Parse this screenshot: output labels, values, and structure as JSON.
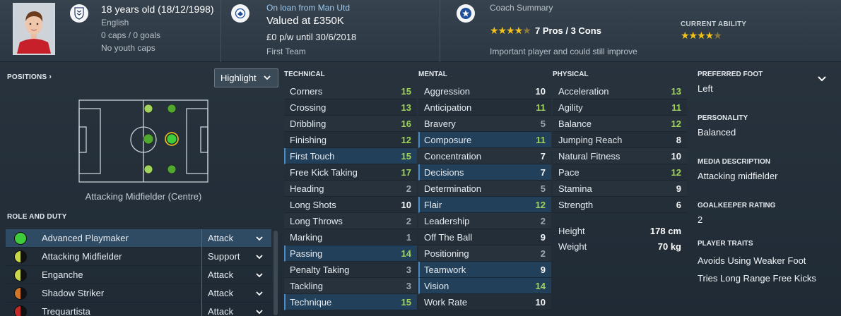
{
  "header": {
    "player": {
      "age_line": "18 years old (18/12/1998)",
      "nationality": "English",
      "caps_goals": "0 caps / 0 goals",
      "youth_caps": "No youth caps"
    },
    "contract": {
      "loan_line": "On loan from Man Utd",
      "value_line": "Valued at £350K",
      "wage_line": "£0 p/w until 30/6/2018",
      "squad_line": "First Team"
    },
    "coach": {
      "title": "Coach Summary",
      "pros_cons": "7 Pros / 3 Cons",
      "summary_stars": 4,
      "summary_text": "Important player and could still improve",
      "current_ability_label": "CURRENT ABILITY",
      "current_ability_stars": 4
    }
  },
  "positions": {
    "title": "POSITIONS",
    "highlight_label": "Highlight",
    "position_label": "Attacking Midfielder (Centre)"
  },
  "role_and_duty": {
    "title": "ROLE AND DUTY",
    "roles": [
      {
        "name": "Advanced Playmaker",
        "duty": "Attack",
        "suitability": "natural"
      },
      {
        "name": "Attacking Midfielder",
        "duty": "Support",
        "suitability": "half"
      },
      {
        "name": "Enganche",
        "duty": "Attack",
        "suitability": "half"
      },
      {
        "name": "Shadow Striker",
        "duty": "Attack",
        "suitability": "half-orange"
      },
      {
        "name": "Trequartista",
        "duty": "Attack",
        "suitability": "half-red"
      }
    ]
  },
  "attributes": {
    "technical": {
      "title": "TECHNICAL",
      "rows": [
        {
          "name": "Corners",
          "value": "15"
        },
        {
          "name": "Crossing",
          "value": "13"
        },
        {
          "name": "Dribbling",
          "value": "16"
        },
        {
          "name": "Finishing",
          "value": "12"
        },
        {
          "name": "First Touch",
          "value": "15"
        },
        {
          "name": "Free Kick Taking",
          "value": "17"
        },
        {
          "name": "Heading",
          "value": "2"
        },
        {
          "name": "Long Shots",
          "value": "10"
        },
        {
          "name": "Long Throws",
          "value": "2"
        },
        {
          "name": "Marking",
          "value": "1"
        },
        {
          "name": "Passing",
          "value": "14"
        },
        {
          "name": "Penalty Taking",
          "value": "3"
        },
        {
          "name": "Tackling",
          "value": "3"
        },
        {
          "name": "Technique",
          "value": "15"
        }
      ]
    },
    "mental": {
      "title": "MENTAL",
      "rows": [
        {
          "name": "Aggression",
          "value": "10"
        },
        {
          "name": "Anticipation",
          "value": "11"
        },
        {
          "name": "Bravery",
          "value": "5"
        },
        {
          "name": "Composure",
          "value": "11"
        },
        {
          "name": "Concentration",
          "value": "7"
        },
        {
          "name": "Decisions",
          "value": "7"
        },
        {
          "name": "Determination",
          "value": "5"
        },
        {
          "name": "Flair",
          "value": "12"
        },
        {
          "name": "Leadership",
          "value": "2"
        },
        {
          "name": "Off The Ball",
          "value": "9"
        },
        {
          "name": "Positioning",
          "value": "2"
        },
        {
          "name": "Teamwork",
          "value": "9"
        },
        {
          "name": "Vision",
          "value": "14"
        },
        {
          "name": "Work Rate",
          "value": "10"
        }
      ]
    },
    "physical": {
      "title": "PHYSICAL",
      "rows": [
        {
          "name": "Acceleration",
          "value": "13"
        },
        {
          "name": "Agility",
          "value": "11"
        },
        {
          "name": "Balance",
          "value": "12"
        },
        {
          "name": "Jumping Reach",
          "value": "8"
        },
        {
          "name": "Natural Fitness",
          "value": "10"
        },
        {
          "name": "Pace",
          "value": "12"
        },
        {
          "name": "Stamina",
          "value": "9"
        },
        {
          "name": "Strength",
          "value": "6"
        }
      ],
      "height_label": "Height",
      "height_value": "178 cm",
      "weight_label": "Weight",
      "weight_value": "70 kg"
    }
  },
  "info": {
    "preferred_foot_label": "PREFERRED FOOT",
    "preferred_foot": "Left",
    "personality_label": "PERSONALITY",
    "personality": "Balanced",
    "media_label": "MEDIA DESCRIPTION",
    "media": "Attacking midfielder",
    "gk_rating_label": "GOALKEEPER RATING",
    "gk_rating": "2",
    "traits_label": "PLAYER TRAITS",
    "traits": [
      "Avoids Using Weaker Foot",
      "Tries Long Range Free Kicks"
    ]
  },
  "colors": {
    "accent_green": "#9fd35b",
    "highlight_row": "#23405a",
    "star_gold": "#f3c319",
    "natural_green": "#3fcc3a"
  },
  "icons": {
    "nation": "england-crest-icon",
    "club": "club-crest-icon",
    "coach": "star-badge-icon",
    "select": "chevron-down-icon"
  }
}
